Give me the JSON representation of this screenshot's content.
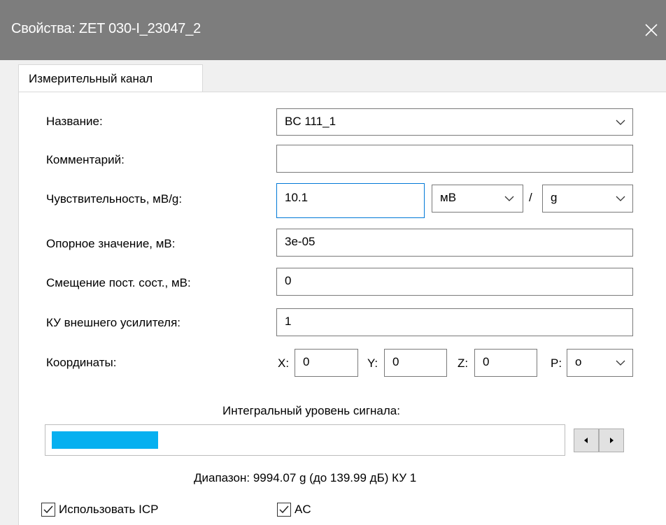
{
  "window": {
    "title": "Свойства: ZET 030-I_23047_2",
    "close_icon": "close-icon"
  },
  "tabs": [
    {
      "label": "Измерительный канал",
      "active": true
    }
  ],
  "form": {
    "name_label": "Название:",
    "name_value": "BC 111_1",
    "comment_label": "Комментарий:",
    "comment_value": "",
    "sensitivity_label": "Чувствительность, мВ/g:",
    "sensitivity_value": "10.1",
    "sensitivity_unit_num": "мВ",
    "sensitivity_separator": "/",
    "sensitivity_unit_den": "g",
    "reference_label": "Опорное значение, мВ:",
    "reference_value": "3e-05",
    "offset_label": "Смещение пост. сост., мВ:",
    "offset_value": "0",
    "gain_label": "КУ внешнего усилителя:",
    "gain_value": "1",
    "coords_label": "Координаты:",
    "coord_x_label": "X:",
    "coord_x_value": "0",
    "coord_y_label": "Y:",
    "coord_y_value": "0",
    "coord_z_label": "Z:",
    "coord_z_value": "0",
    "coord_p_label": "P:",
    "coord_p_value": "o"
  },
  "signal": {
    "title": "Интегральный уровень сигнала:",
    "level": 0.21,
    "fill_color": "#06b0f0",
    "range_text": "Диапазон: 9994.07 g (до 139.99 дБ) КУ 1"
  },
  "checkboxes": {
    "icp_label": "Использовать ICP",
    "icp_checked": true,
    "ac_label": "AC",
    "ac_checked": true
  }
}
